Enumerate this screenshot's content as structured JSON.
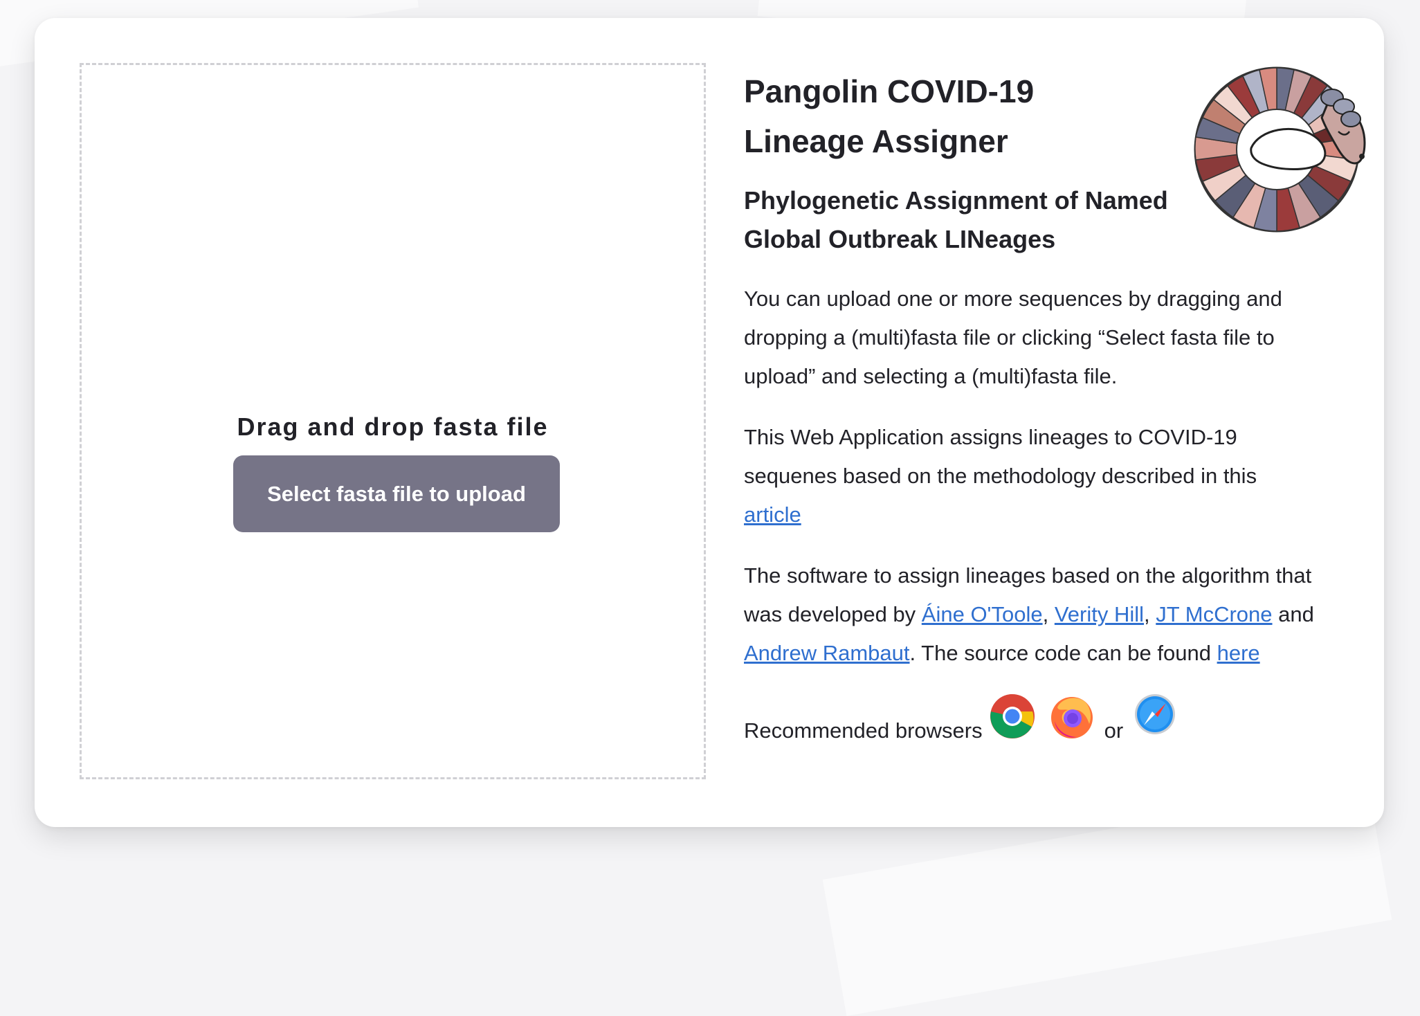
{
  "upload": {
    "drop_label": "Drag and drop fasta file",
    "button_label": "Select fasta file to upload"
  },
  "header": {
    "title": "Pangolin COVID-19 Lineage Assigner",
    "subtitle": "Phylogenetic Assignment of Named Global Outbreak LINeages"
  },
  "intro": {
    "text": "You can upload one or more sequences by dragging and dropping a (multi)fasta file or clicking “Select fasta file to upload” and selecting a (multi)fasta file."
  },
  "about": {
    "text_before": "This Web Application assigns lineages to COVID-19 sequenes based on the methodology described in this ",
    "link_article": "article"
  },
  "credits": {
    "text_1": "The software to assign lineages based on the algorithm that was developed by ",
    "author_1": "Áine O'Toole",
    "sep_1": ", ",
    "author_2": "Verity Hill",
    "sep_2": ", ",
    "author_3": "JT McCrone",
    "text_and": " and ",
    "author_4": "Andrew Rambaut",
    "text_2": ". The source code can be found ",
    "link_here": "here"
  },
  "browsers": {
    "label": "Recommended browsers",
    "or": "or",
    "icons": [
      "chrome-icon",
      "firefox-icon",
      "safari-icon"
    ]
  },
  "colors": {
    "button_bg": "#767487",
    "link": "#2f6fcf",
    "text": "#222228",
    "dashed_border": "#d0d0d4"
  }
}
